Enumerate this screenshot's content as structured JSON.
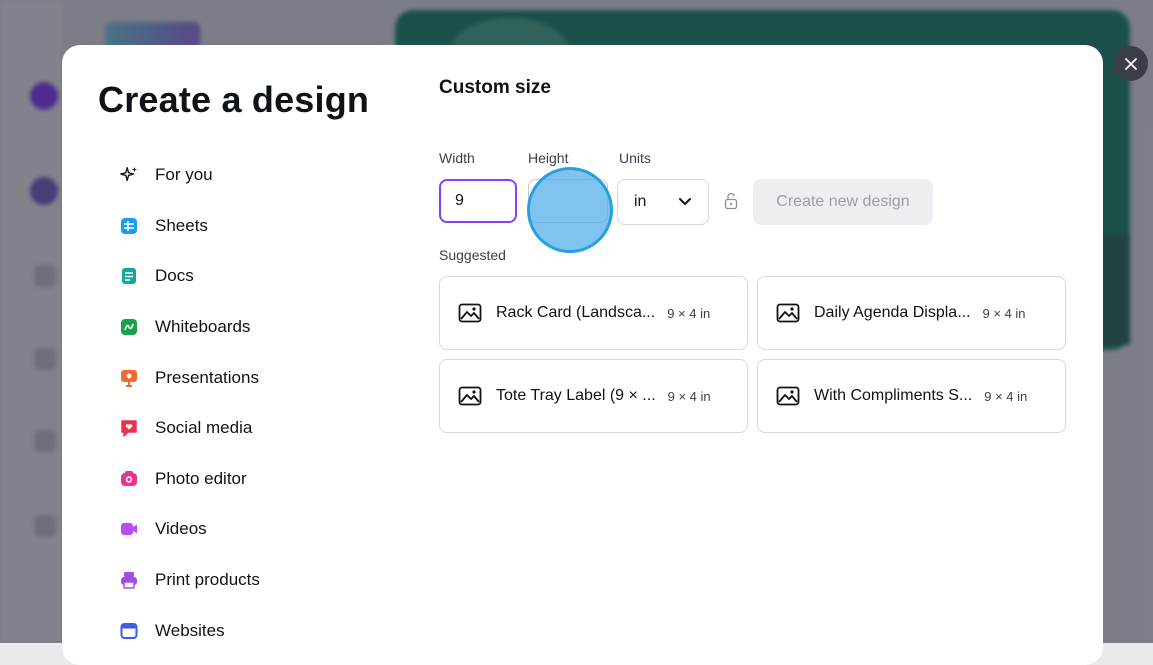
{
  "modal": {
    "title": "Create a design",
    "close_icon": "close-icon"
  },
  "nav": [
    {
      "label": "For you",
      "icon": "sparkle-icon",
      "color": "#0e1318"
    },
    {
      "label": "Sheets",
      "icon": "sheets-icon",
      "color": "#1a9cf0"
    },
    {
      "label": "Docs",
      "icon": "docs-icon",
      "color": "#13a89e"
    },
    {
      "label": "Whiteboards",
      "icon": "whiteboard-icon",
      "color": "#1ba14b"
    },
    {
      "label": "Presentations",
      "icon": "presentation-icon",
      "color": "#f26a2e"
    },
    {
      "label": "Social media",
      "icon": "heart-chat-icon",
      "color": "#e8344e"
    },
    {
      "label": "Photo editor",
      "icon": "camera-icon",
      "color": "#e8358e"
    },
    {
      "label": "Videos",
      "icon": "video-icon",
      "color": "#b84ef2"
    },
    {
      "label": "Print products",
      "icon": "printer-icon",
      "color": "#a44ce6"
    },
    {
      "label": "Websites",
      "icon": "browser-icon",
      "color": "#3b5af1"
    }
  ],
  "custom_size": {
    "title": "Custom size",
    "width_label": "Width",
    "height_label": "Height",
    "units_label": "Units",
    "width_value": "9",
    "height_value": "",
    "units_value": "in",
    "create_button": "Create new design"
  },
  "suggested": {
    "label": "Suggested",
    "items": [
      {
        "name": "Rack Card (Landsca...",
        "size": "9 × 4 in"
      },
      {
        "name": "Daily Agenda Displa...",
        "size": "9 × 4 in"
      },
      {
        "name": "Tote Tray Label (9 × ...",
        "size": "9 × 4 in"
      },
      {
        "name": "With Compliments S...",
        "size": "9 × 4 in"
      }
    ]
  },
  "colors": {
    "accent": "#8b3dff",
    "text": "#0e1318",
    "disabled_button_bg": "#eceef1",
    "disabled_button_text": "#9a9fa8"
  }
}
